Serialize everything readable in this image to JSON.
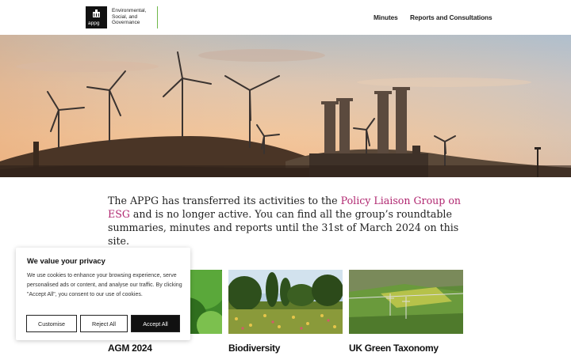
{
  "header": {
    "logo_text": "appg",
    "org_name_lines": [
      "Environmental,",
      "Social, and",
      "Governance"
    ],
    "nav": [
      {
        "label": "Minutes"
      },
      {
        "label": "Reports and Consultations"
      }
    ]
  },
  "hero": {
    "image": "wind-turbines-and-power-plant-at-sunset"
  },
  "intro": {
    "text_before": "The APPG has transferred its activities to the ",
    "link_text": "Policy Liaison Group on ESG",
    "text_after": " and is no longer active. You can find all the group’s roundtable summaries, minutes and reports until the 31st of March 2024 on this site."
  },
  "cards": [
    {
      "title": "AGM 2024",
      "image": "green-foliage"
    },
    {
      "title": "Biodiversity",
      "image": "wildflower-meadow"
    },
    {
      "title": "UK Green Taxonomy",
      "image": "aerial-farmland-with-pylons"
    }
  ],
  "cookie_banner": {
    "title": "We value your privacy",
    "body": "We use cookies to enhance your browsing experience, serve personalised ads or content, and analyse our traffic. By clicking \"Accept All\", you consent to our use of cookies.",
    "buttons": {
      "customise": "Customise",
      "reject": "Reject All",
      "accept": "Accept All"
    }
  },
  "colors": {
    "accent_link": "#b02770",
    "logo_rule": "#6fb84a",
    "dark": "#111111"
  }
}
